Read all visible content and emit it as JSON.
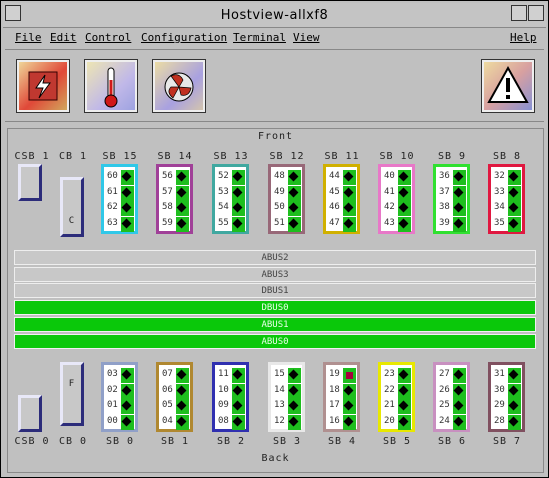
{
  "window": {
    "title": "Hostview-allxf8"
  },
  "menu": {
    "items": [
      "File",
      "Edit",
      "Control",
      "Configuration",
      "Terminal",
      "View"
    ],
    "help": "Help"
  },
  "toolbar": {
    "icons": [
      "power-icon",
      "thermometer-icon",
      "fan-icon",
      "warning-icon"
    ]
  },
  "panel": {
    "front_label": "Front",
    "back_label": "Back"
  },
  "front": {
    "csb": {
      "label": "CSB 1"
    },
    "cb": {
      "label": "CB 1",
      "text": "C"
    },
    "boards": [
      {
        "label": "SB 15",
        "nums": [
          "60",
          "61",
          "62",
          "63"
        ],
        "color": "#30c8e8"
      },
      {
        "label": "SB 14",
        "nums": [
          "56",
          "57",
          "58",
          "59"
        ],
        "color": "#a04098"
      },
      {
        "label": "SB 13",
        "nums": [
          "52",
          "53",
          "54",
          "55"
        ],
        "color": "#40a8a0"
      },
      {
        "label": "SB 12",
        "nums": [
          "48",
          "49",
          "50",
          "51"
        ],
        "color": "#986878"
      },
      {
        "label": "SB 11",
        "nums": [
          "44",
          "45",
          "46",
          "47"
        ],
        "color": "#d0b000"
      },
      {
        "label": "SB 10",
        "nums": [
          "40",
          "41",
          "42",
          "43"
        ],
        "color": "#e878c8"
      },
      {
        "label": "SB 9",
        "nums": [
          "36",
          "37",
          "38",
          "39"
        ],
        "color": "#30e030"
      },
      {
        "label": "SB 8",
        "nums": [
          "32",
          "33",
          "34",
          "35"
        ],
        "color": "#e01840"
      }
    ]
  },
  "buses": [
    {
      "label": "ABUS2",
      "state": "grey"
    },
    {
      "label": "ABUS3",
      "state": "grey"
    },
    {
      "label": "DBUS1",
      "state": "grey"
    },
    {
      "label": "DBUS0",
      "state": "green"
    },
    {
      "label": "ABUS1",
      "state": "green"
    },
    {
      "label": "ABUS0",
      "state": "green"
    }
  ],
  "back": {
    "csb": {
      "label": "CSB 0"
    },
    "cb": {
      "label": "CB 0",
      "text": "F"
    },
    "boards": [
      {
        "label": "SB 0",
        "nums": [
          "03",
          "02",
          "01",
          "00"
        ],
        "color": "#90a0c8"
      },
      {
        "label": "SB 1",
        "nums": [
          "07",
          "06",
          "05",
          "04"
        ],
        "color": "#b08830"
      },
      {
        "label": "SB 2",
        "nums": [
          "11",
          "10",
          "09",
          "08"
        ],
        "color": "#3030b0"
      },
      {
        "label": "SB 3",
        "nums": [
          "15",
          "14",
          "13",
          "12"
        ],
        "color": "#e8e8e8"
      },
      {
        "label": "SB 4",
        "nums": [
          "19",
          "18",
          "17",
          "16"
        ],
        "color": "#b09090",
        "red_first": true
      },
      {
        "label": "SB 5",
        "nums": [
          "23",
          "22",
          "21",
          "20"
        ],
        "color": "#e8e800"
      },
      {
        "label": "SB 6",
        "nums": [
          "27",
          "26",
          "25",
          "24"
        ],
        "color": "#c890c0"
      },
      {
        "label": "SB 7",
        "nums": [
          "31",
          "30",
          "29",
          "28"
        ],
        "color": "#805060"
      }
    ]
  }
}
